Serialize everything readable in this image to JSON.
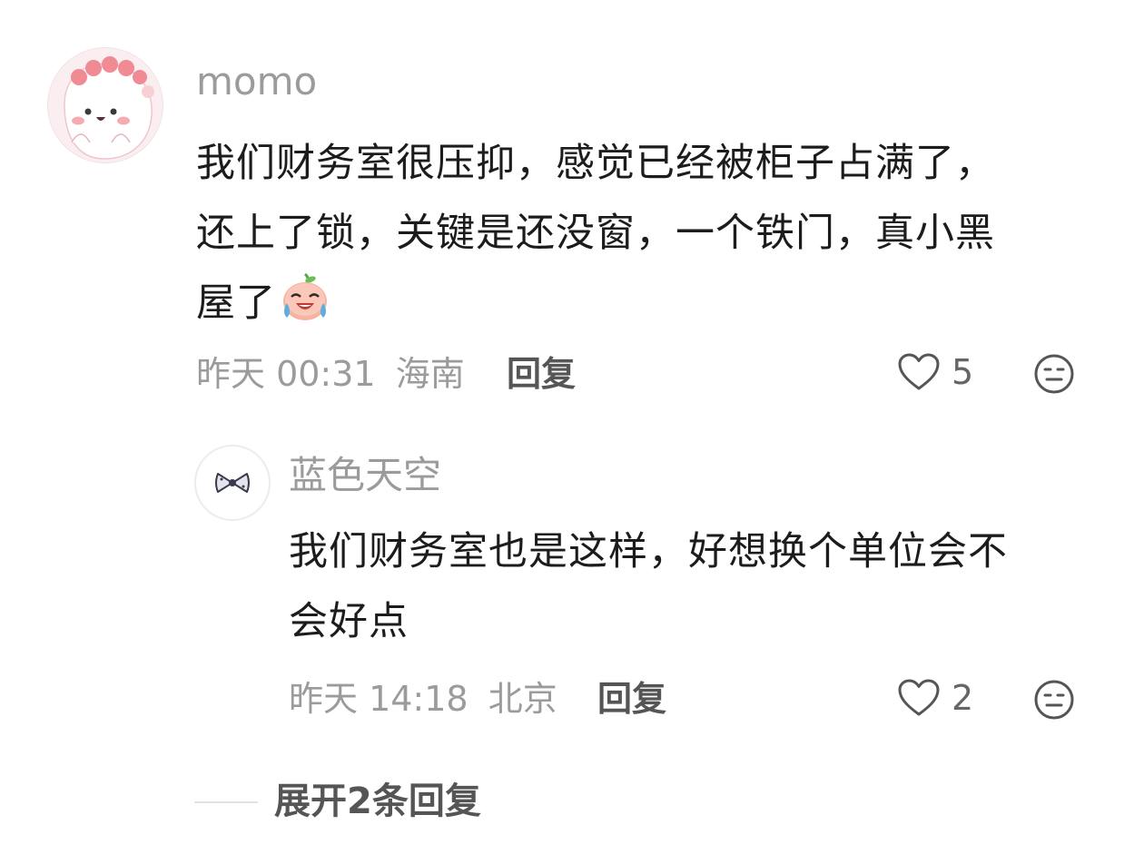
{
  "comment": {
    "avatar_icon": "pink-character-avatar-icon",
    "username": "momo",
    "text_lines": [
      "我们财务室很压抑，感觉已经被柜子占满了，",
      "还上了锁，关键是还没窗，一个铁门，真小黑",
      "屋了"
    ],
    "emoji_icon": "crying-laughing-emoji-icon",
    "time": "昨天 00:31",
    "location": "海南",
    "reply_label": "回复",
    "likes": "5"
  },
  "reply": {
    "avatar_icon": "bow-avatar-icon",
    "username": "蓝色天空",
    "text_lines": [
      "我们财务室也是这样，好想换个单位会不",
      "会好点"
    ],
    "time": "昨天 14:18",
    "location": "北京",
    "reply_label": "回复",
    "likes": "2"
  },
  "expand_label": "展开2条回复",
  "colors": {
    "text_primary": "#1c1c1c",
    "text_secondary": "#9b9b9b",
    "text_action": "#555555"
  }
}
